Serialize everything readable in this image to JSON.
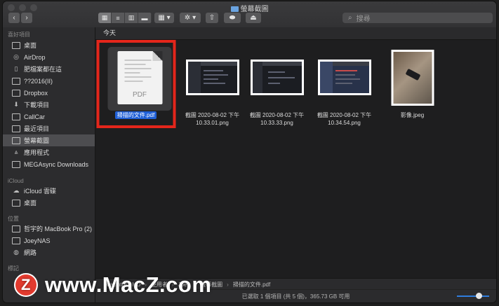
{
  "window": {
    "title": "螢幕截圖"
  },
  "toolbar": {
    "back_icon": "chevron-left-icon",
    "forward_icon": "chevron-right-icon",
    "action_icon": "gear-icon",
    "share_icon": "share-icon",
    "search_placeholder": "搜尋"
  },
  "sidebar": {
    "favorites_header": "喜好項目",
    "favorites": [
      {
        "label": "桌面",
        "icon": "desktop-icon"
      },
      {
        "label": "AirDrop",
        "icon": "airdrop-icon"
      },
      {
        "label": "肥檔案都在這",
        "icon": "document-icon"
      },
      {
        "label": "??2016(II)",
        "icon": "folder-icon"
      },
      {
        "label": "Dropbox",
        "icon": "folder-icon"
      },
      {
        "label": "下載項目",
        "icon": "download-icon"
      },
      {
        "label": "CallCar",
        "icon": "folder-icon"
      },
      {
        "label": "最近項目",
        "icon": "recents-icon"
      },
      {
        "label": "螢幕截圖",
        "icon": "folder-icon",
        "selected": true
      },
      {
        "label": "應用程式",
        "icon": "applications-icon"
      },
      {
        "label": "MEGAsync Downloads",
        "icon": "folder-icon"
      }
    ],
    "icloud_header": "iCloud",
    "icloud": [
      {
        "label": "iCloud 雲碟",
        "icon": "cloud-icon"
      },
      {
        "label": "桌面",
        "icon": "desktop-icon"
      }
    ],
    "locations_header": "位置",
    "locations": [
      {
        "label": "哲宇的 MacBook Pro (2)",
        "icon": "laptop-icon"
      },
      {
        "label": "JoeyNAS",
        "icon": "server-icon"
      },
      {
        "label": "網路",
        "icon": "globe-icon"
      }
    ],
    "tags_header": "標記"
  },
  "main": {
    "section": "今天",
    "files": [
      {
        "name": "掃描的文件.pdf",
        "line2": "",
        "kind": "pdf",
        "selected": true,
        "thumb_label": "PDF"
      },
      {
        "name": "截圖 2020-08-02 下午",
        "line2": "10.33.01.png",
        "kind": "screenshot"
      },
      {
        "name": "截圖 2020-08-02 下午",
        "line2": "10.33.33.png",
        "kind": "screenshot"
      },
      {
        "name": "截圖 2020-08-02 下午",
        "line2": "10.34.54.png",
        "kind": "screenshot"
      },
      {
        "name": "影像.jpeg",
        "line2": "",
        "kind": "photo"
      }
    ]
  },
  "pathbar": {
    "items": [
      "Macintosh HD",
      "使用者",
      "Joey",
      "螢幕截圖",
      "掃描的文件.pdf"
    ]
  },
  "statusbar": {
    "text": "已選取 1 個項目 (共 5 個)，365.73 GB 可用"
  },
  "watermark": {
    "logo": "Z",
    "text": "www.MacZ.com"
  },
  "colors": {
    "selection": "#1f5fd6",
    "highlight_box": "#e4261b",
    "slider": "#2f7dde"
  }
}
